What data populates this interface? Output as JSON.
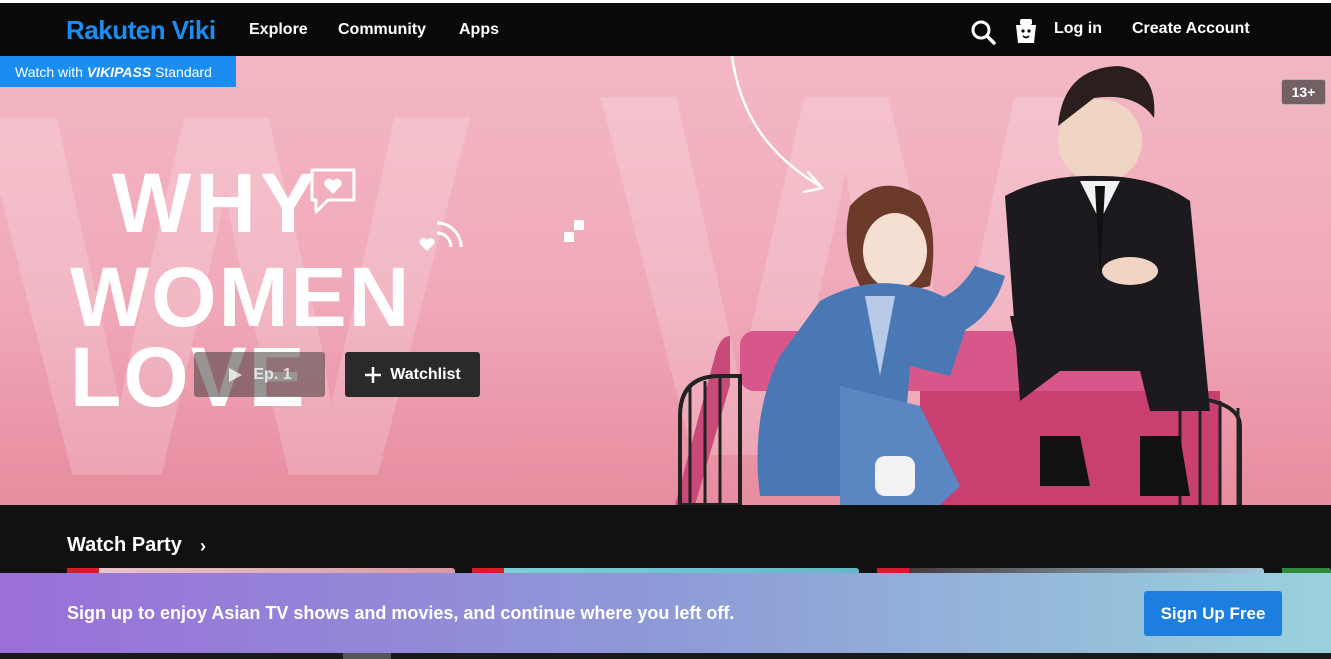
{
  "nav": {
    "logo": "Rakuten Viki",
    "links": [
      "Explore",
      "Community",
      "Apps"
    ],
    "login": "Log in",
    "create_account": "Create Account",
    "icons": [
      "search-icon",
      "kids-mode-icon"
    ]
  },
  "hero": {
    "vikipass_prefix": "Watch with ",
    "vikipass_brand": "VIKIPASS",
    "vikipass_suffix": " Standard",
    "rating": "13+",
    "title_line1": "WHY",
    "title_line2": "WOMEN LOVE",
    "episode_button": "Ep. 1",
    "watchlist_button": "Watchlist"
  },
  "watch_party": {
    "title": "Watch Party",
    "chevron": "›"
  },
  "signup_banner": {
    "text": "Sign up to enjoy Asian TV shows and movies, and continue where you left off.",
    "button": "Sign Up Free"
  },
  "colors": {
    "brand_blue": "#1c8df0",
    "nav_bg": "#0a0a0a",
    "hero_pink": "#f0a8b8",
    "live_red": "#d21d2b",
    "button_blue": "#1c7ee0"
  }
}
